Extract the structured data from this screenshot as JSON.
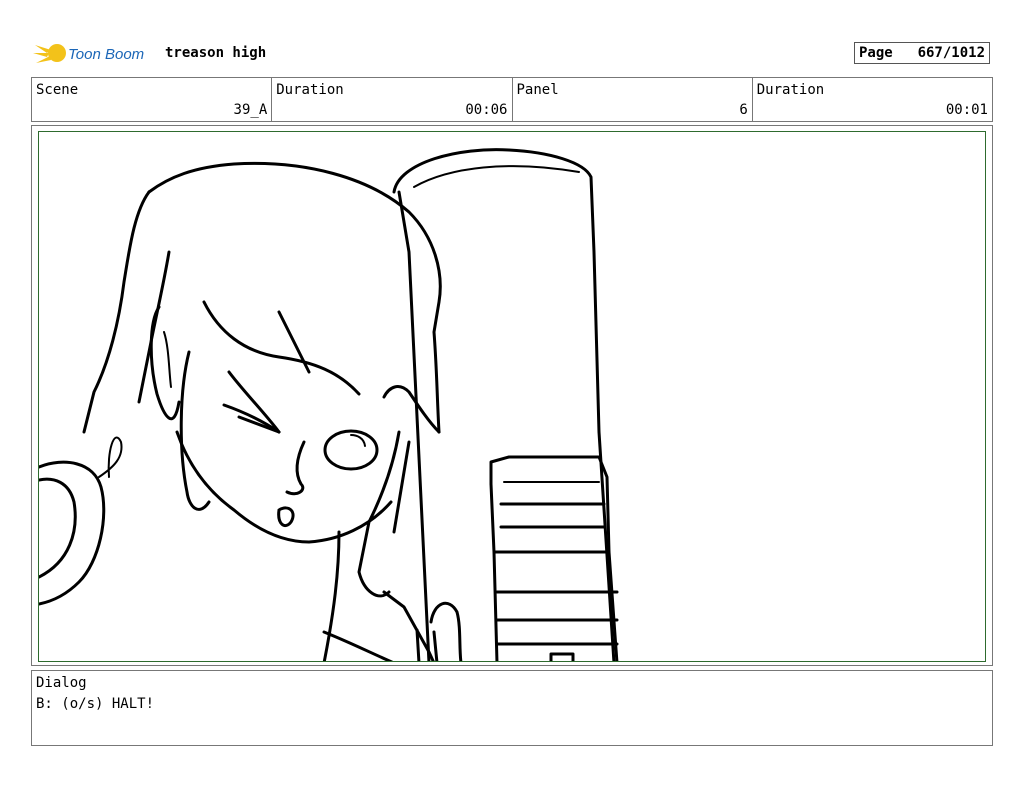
{
  "header": {
    "logo_icon": "toon-boom-logo",
    "logo_text": "Toon Boom",
    "project_title": "treason high",
    "page_label": "Page",
    "page_value": "667/1012"
  },
  "info": {
    "scene_label": "Scene",
    "scene_value": "39_A",
    "scene_duration_label": "Duration",
    "scene_duration_value": "00:06",
    "panel_label": "Panel",
    "panel_value": "6",
    "panel_duration_label": "Duration",
    "panel_duration_value": "00:01"
  },
  "panel": {
    "frame_color": "#2e6b2e",
    "drawing": "character-sketch-with-telescope"
  },
  "dialog": {
    "label": "Dialog",
    "text": "B: (o/s) HALT!"
  }
}
